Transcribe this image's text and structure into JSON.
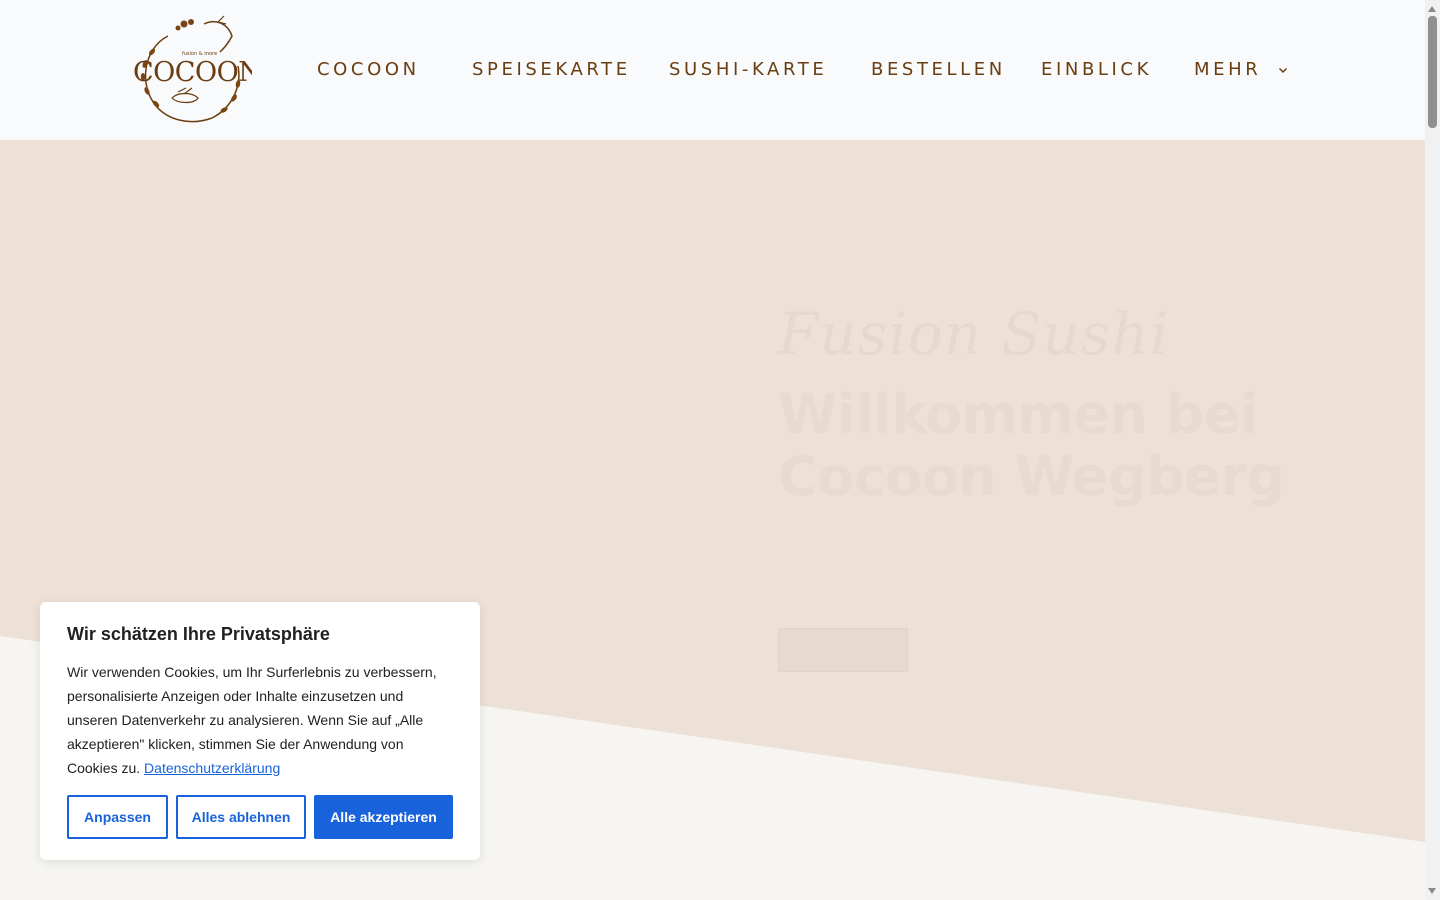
{
  "brand": {
    "name": "COCOON",
    "tagline": "fusion & more",
    "color": "#6b3d10"
  },
  "nav": {
    "items": [
      {
        "label": "COCOON",
        "has_dropdown": false
      },
      {
        "label": "SPEISEKARTE",
        "has_dropdown": false
      },
      {
        "label": "SUSHI-KARTE",
        "has_dropdown": false
      },
      {
        "label": "BESTELLEN",
        "has_dropdown": false
      },
      {
        "label": "EINBLICK",
        "has_dropdown": false
      },
      {
        "label": "MEHR",
        "has_dropdown": true,
        "icon": "chevron-down-icon"
      }
    ]
  },
  "hero": {
    "script_text": "Fusion Sushi",
    "title": "Willkommen bei Cocoon Wegberg",
    "background": "#ede1d7",
    "lower_band": "#f6f5f1"
  },
  "cookie_banner": {
    "title": "Wir schätzen Ihre Privatsphäre",
    "text": "Wir verwenden Cookies, um Ihr Surferlebnis zu verbessern, personalisierte Anzeigen oder Inhalte einzusetzen und unseren Datenverkehr zu analysieren. Wenn Sie auf „Alle akzeptieren\" klicken, stimmen Sie der Anwendung von Cookies zu.",
    "link_label": "Datenschutzerklärung",
    "buttons": {
      "customize": "Anpassen",
      "reject": "Alles ablehnen",
      "accept": "Alle akzeptieren"
    },
    "accent": "#1863dc"
  }
}
